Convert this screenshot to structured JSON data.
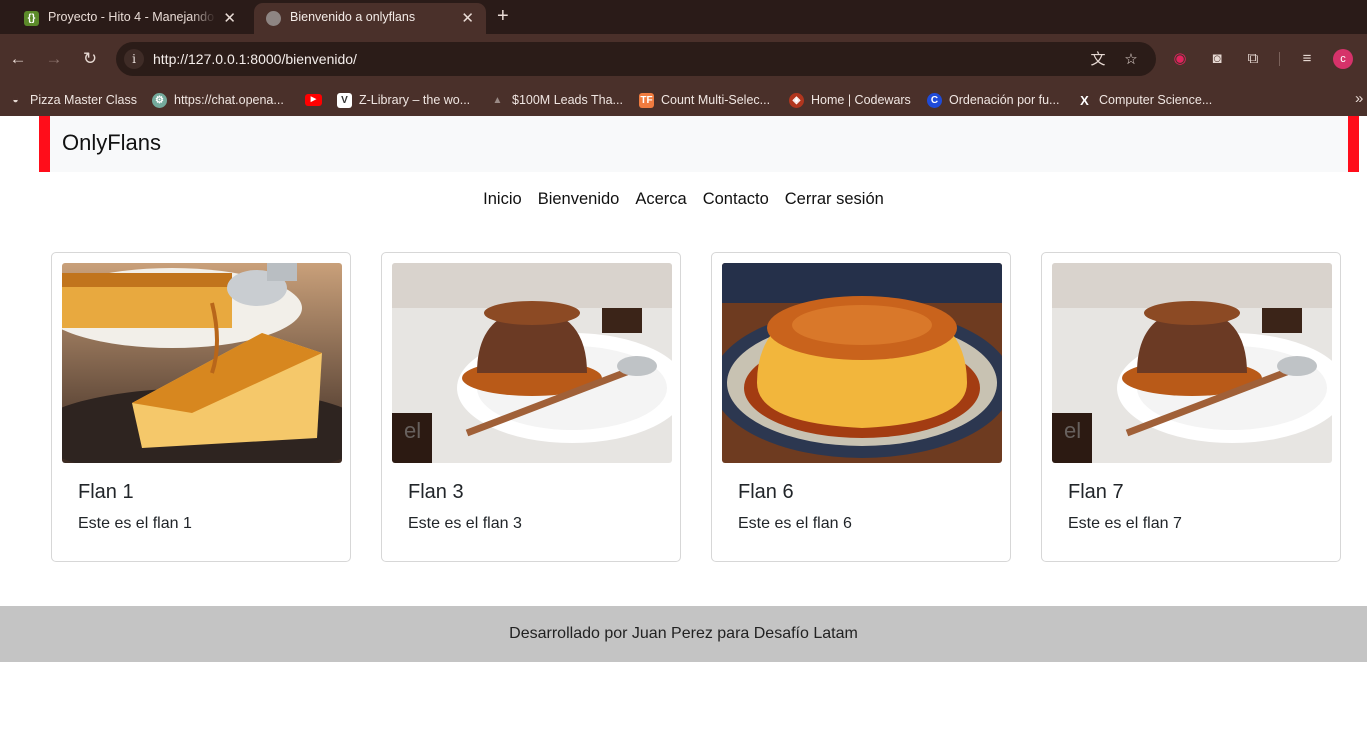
{
  "browser": {
    "tabs": [
      {
        "title": "Proyecto - Hito 4 - Manejando",
        "favicon": "{}"
      },
      {
        "title": "Bienvenido a onlyflans"
      }
    ],
    "url": "http://127.0.0.1:8000/bienvenido/",
    "bookmarks": [
      {
        "label": "Pizza Master Class",
        "icon": "pizza-icon"
      },
      {
        "label": "https://chat.opena...",
        "icon": "openai-icon"
      },
      {
        "label": "",
        "icon": "youtube-icon"
      },
      {
        "label": "Z-Library – the wo...",
        "icon": "zlibrary-icon"
      },
      {
        "label": "$100M Leads Tha...",
        "icon": "triangle-icon"
      },
      {
        "label": "Count Multi-Selec...",
        "icon": "tf-icon"
      },
      {
        "label": "Home | Codewars",
        "icon": "codewars-icon"
      },
      {
        "label": "Ordenación por fu...",
        "icon": "c-icon"
      },
      {
        "label": "Computer Science...",
        "icon": "x-icon"
      }
    ]
  },
  "site": {
    "brand": "OnlyFlans",
    "nav": [
      "Inicio",
      "Bienvenido",
      "Acerca",
      "Contacto",
      "Cerrar sesión"
    ],
    "cards": [
      {
        "title": "Flan 1",
        "text": "Este es el flan 1",
        "image": "caramel-flan-slice-photo"
      },
      {
        "title": "Flan 3",
        "text": "Este es el flan 3",
        "image": "chocolate-flan-photo"
      },
      {
        "title": "Flan 6",
        "text": "Este es el flan 6",
        "image": "caramel-flan-whole-photo"
      },
      {
        "title": "Flan 7",
        "text": "Este es el flan 7",
        "image": "chocolate-flan-photo"
      }
    ],
    "footer": "Desarrollado por Juan Perez para Desafío Latam"
  },
  "colors": {
    "brand_accent": "#ff0d1a",
    "footer_bg": "#c4c4c4",
    "brandbar_bg": "#f8f9fa"
  }
}
